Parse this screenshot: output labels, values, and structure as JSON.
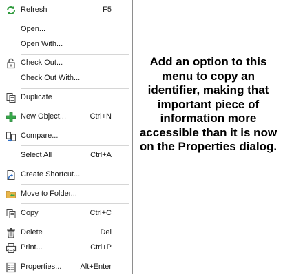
{
  "menu": {
    "refresh": {
      "label": "Refresh",
      "shortcut": "F5"
    },
    "open": {
      "label": "Open..."
    },
    "open_with": {
      "label": "Open With..."
    },
    "check_out": {
      "label": "Check Out..."
    },
    "check_out_with": {
      "label": "Check Out With..."
    },
    "duplicate": {
      "label": "Duplicate"
    },
    "new_object": {
      "label": "New Object...",
      "shortcut": "Ctrl+N"
    },
    "compare": {
      "label": "Compare..."
    },
    "select_all": {
      "label": "Select All",
      "shortcut": "Ctrl+A"
    },
    "create_shortcut": {
      "label": "Create Shortcut..."
    },
    "move_to_folder": {
      "label": "Move to Folder..."
    },
    "copy": {
      "label": "Copy",
      "shortcut": "Ctrl+C"
    },
    "delete": {
      "label": "Delete",
      "shortcut": "Del"
    },
    "print": {
      "label": "Print...",
      "shortcut": "Ctrl+P"
    },
    "properties": {
      "label": "Properties...",
      "shortcut": "Alt+Enter"
    }
  },
  "annotation": {
    "text": "Add an option to this menu to copy an identifier, making that important piece of information more accessible than it is now on the Properties dialog."
  },
  "colors": {
    "refresh_green": "#2e9a3c",
    "plus_green": "#36a84a",
    "folder_yellow": "#e8b64a"
  }
}
